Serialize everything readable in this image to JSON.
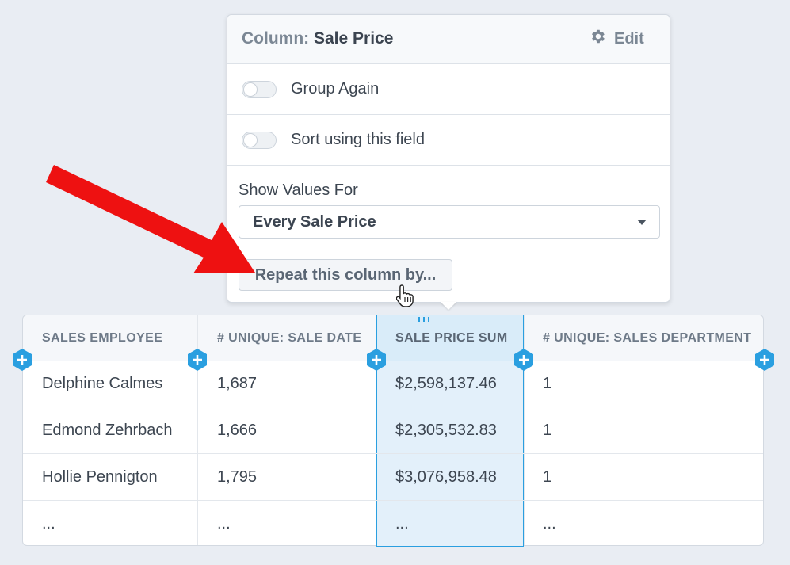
{
  "popover": {
    "title_prefix": "Column:",
    "title_value": "Sale Price",
    "edit_label": "Edit",
    "group_again_label": "Group Again",
    "group_again_on": false,
    "sort_label": "Sort using this field",
    "sort_on": false,
    "show_values_label": "Show Values For",
    "show_values_selected": "Every Sale Price",
    "repeat_button_label": "Repeat this column by..."
  },
  "table": {
    "columns": [
      "SALES EMPLOYEE",
      "# UNIQUE: SALE DATE",
      "SALE PRICE SUM",
      "# UNIQUE: SALES DEPARTMENT"
    ],
    "selected_column_index": 2,
    "rows": [
      [
        "Delphine Calmes",
        "1,687",
        "$2,598,137.46",
        "1"
      ],
      [
        "Edmond Zehrbach",
        "1,666",
        "$2,305,532.83",
        "1"
      ],
      [
        "Hollie Pennigton",
        "1,795",
        "$3,076,958.48",
        "1"
      ],
      [
        "...",
        "...",
        "...",
        "..."
      ]
    ]
  },
  "icons": {
    "gear": "gear-icon",
    "add_column": "plus-icon",
    "arrow": "red-arrow-annotation",
    "cursor": "hand-pointer-cursor"
  },
  "colors": {
    "accent": "#2a9fe0",
    "selected_column_bg": "#e3f0fa",
    "annotation_arrow": "#ee1111"
  }
}
